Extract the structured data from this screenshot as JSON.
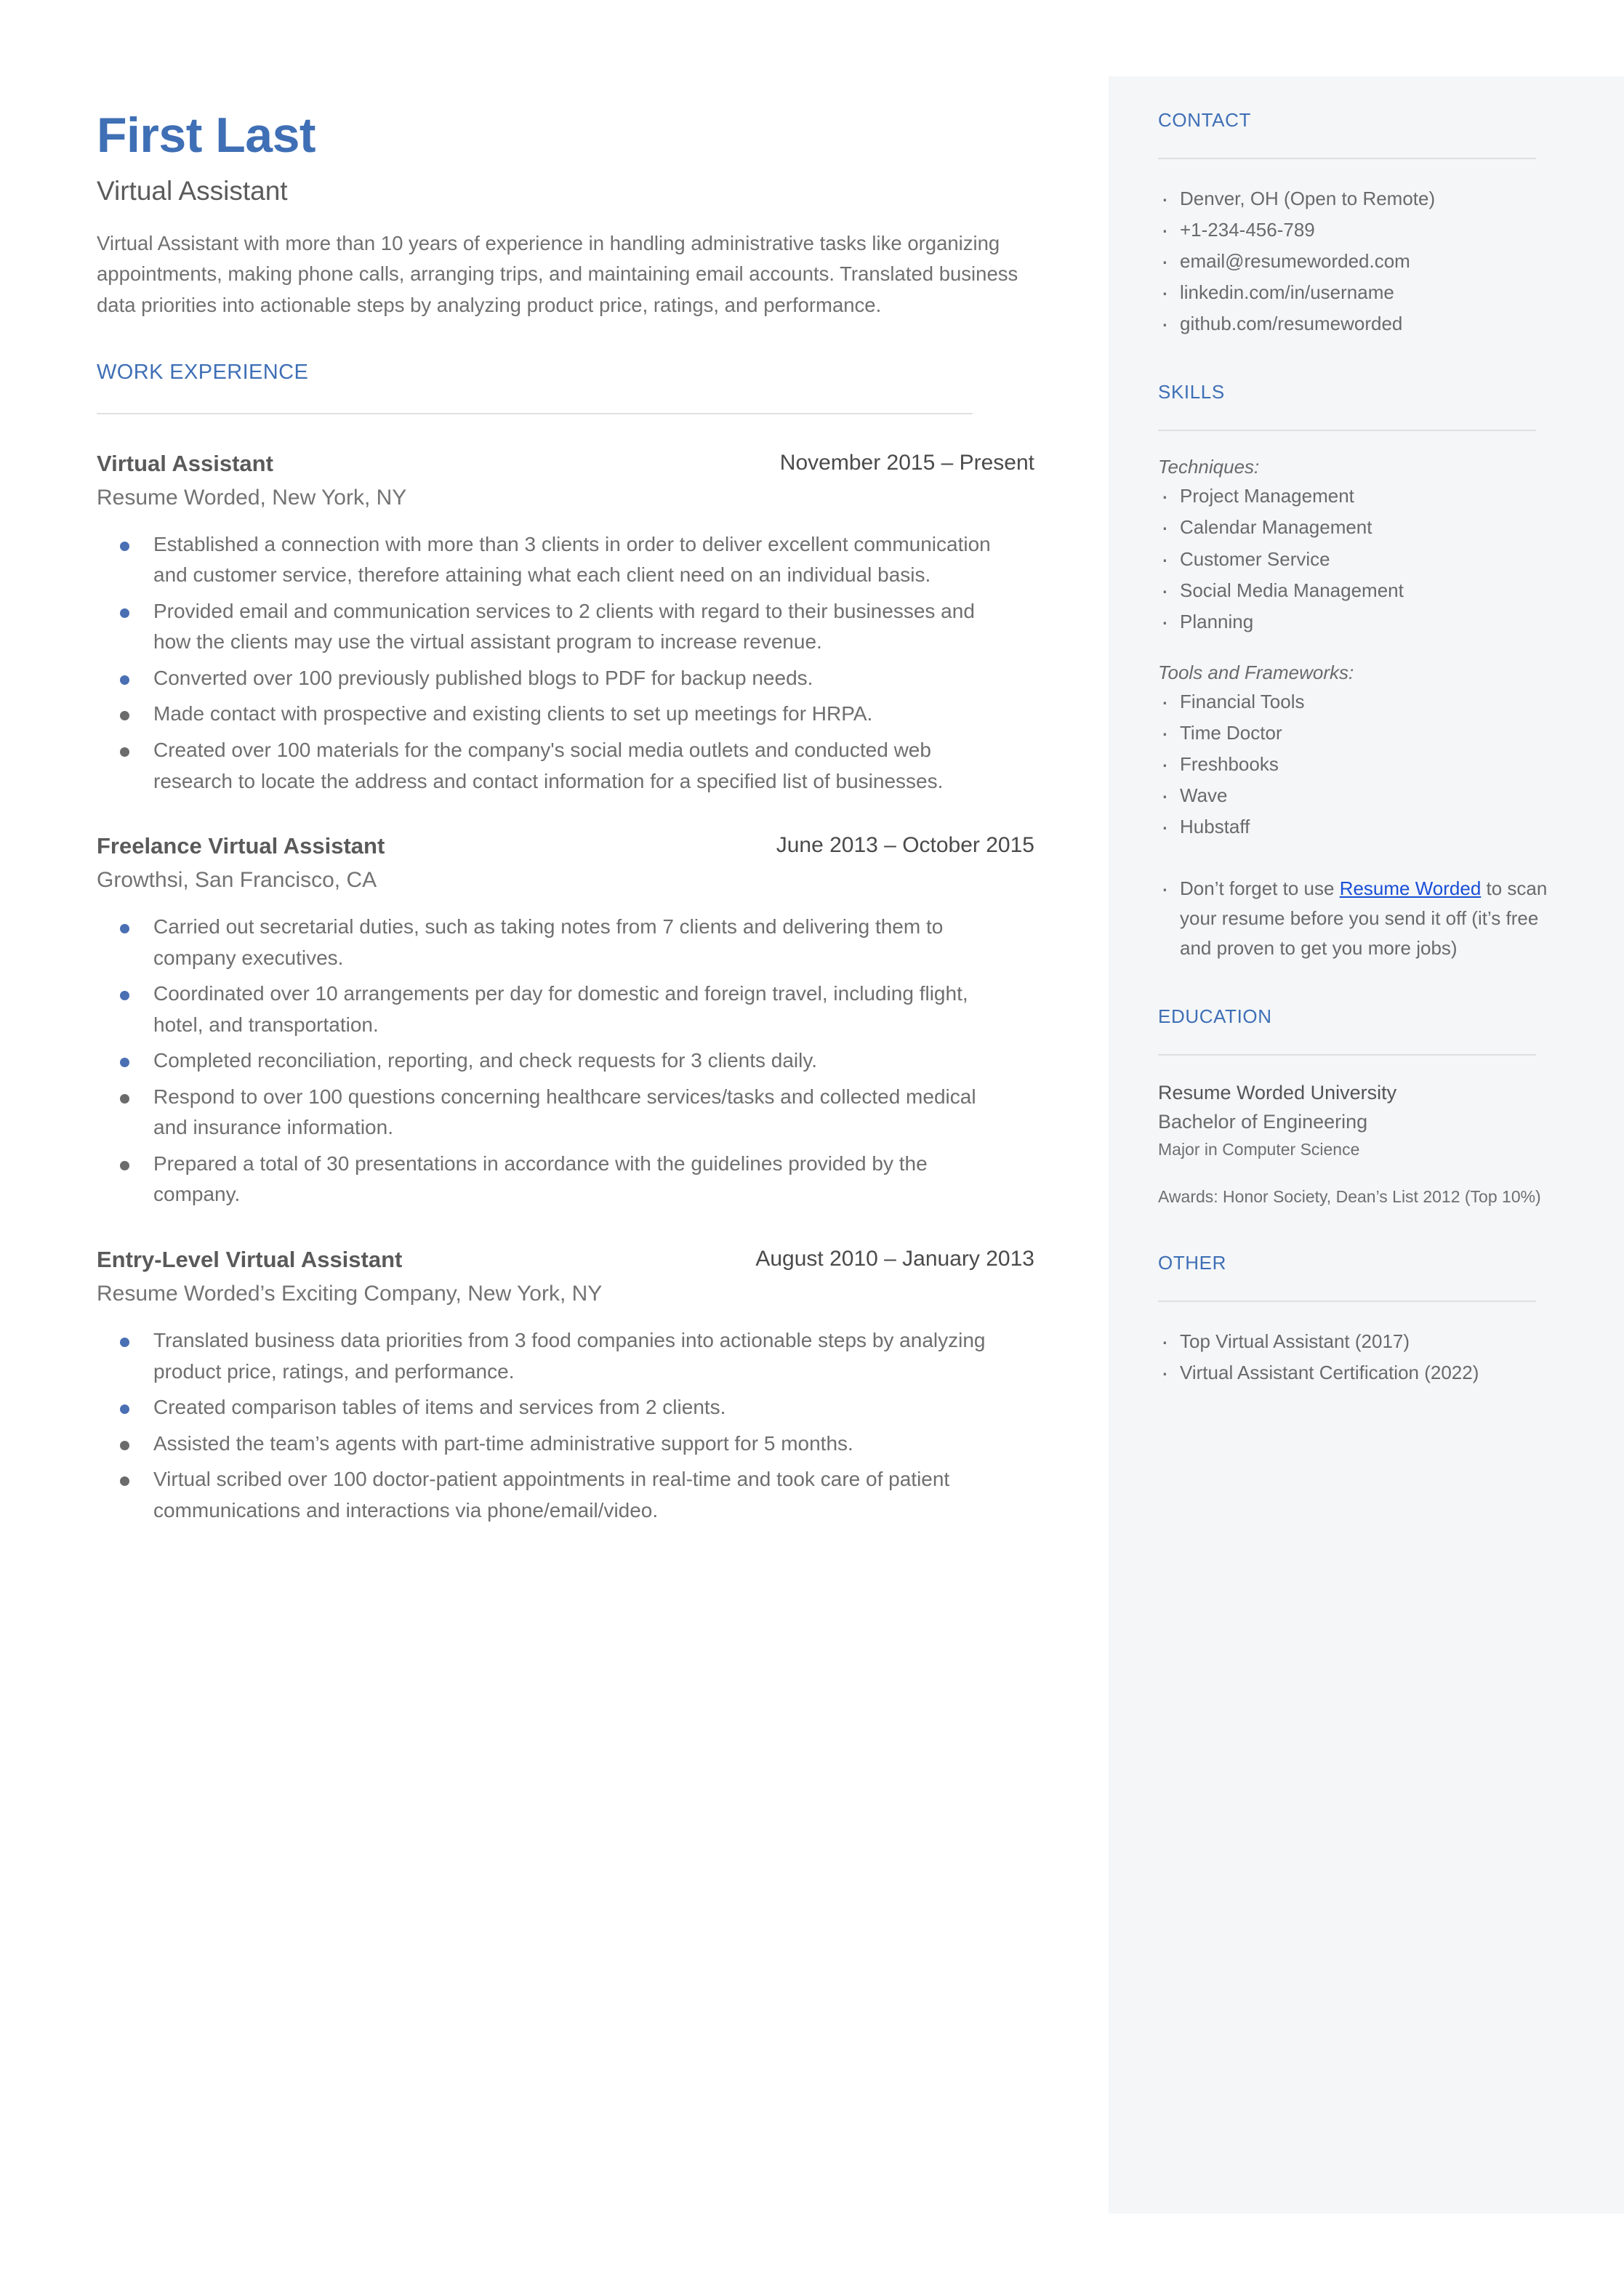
{
  "colors": {
    "accent_blue": "#3f6fb5",
    "bullet_blue": "#4a6fb3",
    "bullet_gray": "#6b6b6b",
    "link_blue": "#1a4fd6",
    "sidebar_bg": "#f4f6f8",
    "body_text": "#6f6f6f"
  },
  "header": {
    "name": "First Last",
    "title": "Virtual Assistant",
    "summary": "Virtual Assistant with more than 10 years of experience in handling administrative tasks like organizing appointments, making phone calls, arranging trips, and maintaining email accounts. Translated business data priorities into actionable steps by analyzing product price, ratings, and performance."
  },
  "work": {
    "heading": "WORK EXPERIENCE",
    "jobs": [
      {
        "role": "Virtual Assistant",
        "dates": "November 2015 – Present",
        "company": "Resume Worded, New York, NY",
        "bullets": [
          {
            "text": "Established a connection with more than 3 clients in order to deliver excellent communication and customer service, therefore attaining what each client need on an individual basis.",
            "color": "blue"
          },
          {
            "text": "Provided email and communication services to 2 clients with regard to their businesses and how the clients may use the virtual assistant program to increase revenue.",
            "color": "blue"
          },
          {
            "text": "Converted over 100 previously published blogs to PDF for backup needs.",
            "color": "blue"
          },
          {
            "text": "Made contact with prospective and existing clients to set up meetings for HRPA.",
            "color": "gray"
          },
          {
            "text": "Created over 100 materials for the company's social media outlets and conducted web research to locate the address and contact information for a specified list of businesses.",
            "color": "gray"
          }
        ]
      },
      {
        "role": "Freelance Virtual Assistant",
        "dates": "June 2013 – October 2015",
        "company": "Growthsi, San Francisco, CA",
        "bullets": [
          {
            "text": "Carried out secretarial duties, such as taking notes from 7 clients and delivering them to company executives.",
            "color": "blue"
          },
          {
            "text": "Coordinated over 10 arrangements per day for domestic and foreign travel, including flight, hotel, and transportation.",
            "color": "blue"
          },
          {
            "text": "Completed reconciliation, reporting, and check requests for 3 clients daily.",
            "color": "blue"
          },
          {
            "text": "Respond to over 100 questions concerning healthcare services/tasks and collected medical and insurance information.",
            "color": "gray"
          },
          {
            "text": "Prepared a total of 30 presentations in accordance with the guidelines provided by the company.",
            "color": "gray"
          }
        ]
      },
      {
        "role": "Entry-Level Virtual Assistant",
        "dates": "August 2010 – January 2013",
        "company": "Resume Worded’s Exciting Company, New York, NY",
        "bullets": [
          {
            "text": "Translated business data priorities from 3 food companies into actionable steps by analyzing product price, ratings, and performance.",
            "color": "blue"
          },
          {
            "text": "Created comparison tables of items and services from 2 clients.",
            "color": "blue"
          },
          {
            "text": "Assisted the team’s agents with part-time administrative support for 5 months.",
            "color": "gray"
          },
          {
            "text": "Virtual scribed over 100 doctor-patient appointments in real-time and took care of patient communications and interactions via phone/email/video.",
            "color": "gray"
          }
        ]
      }
    ]
  },
  "sidebar": {
    "contact": {
      "heading": "CONTACT",
      "items": [
        "Denver, OH (Open to Remote)",
        "+1-234-456-789",
        "email@resumeworded.com",
        "linkedin.com/in/username",
        "github.com/resumeworded"
      ]
    },
    "skills": {
      "heading": "SKILLS",
      "groups": [
        {
          "label": "Techniques:",
          "items": [
            "Project Management",
            "Calendar Management",
            "Customer Service",
            "Social Media Management",
            "Planning"
          ]
        },
        {
          "label": "Tools and Frameworks:",
          "items": [
            "Financial Tools",
            "Time Doctor",
            "Freshbooks",
            "Wave",
            "Hubstaff"
          ]
        }
      ],
      "promo": {
        "before": "Don’t forget to use ",
        "link": "Resume Worded",
        "after": " to scan your resume before you send it off (it’s free and proven to get you more jobs)"
      }
    },
    "education": {
      "heading": "EDUCATION",
      "school": "Resume Worded University",
      "degree": "Bachelor of Engineering",
      "major": "Major in Computer Science",
      "awards": "Awards: Honor Society, Dean’s List 2012 (Top 10%)"
    },
    "other": {
      "heading": "OTHER",
      "items": [
        "Top Virtual Assistant (2017)",
        "Virtual Assistant Certification (2022)"
      ]
    }
  }
}
